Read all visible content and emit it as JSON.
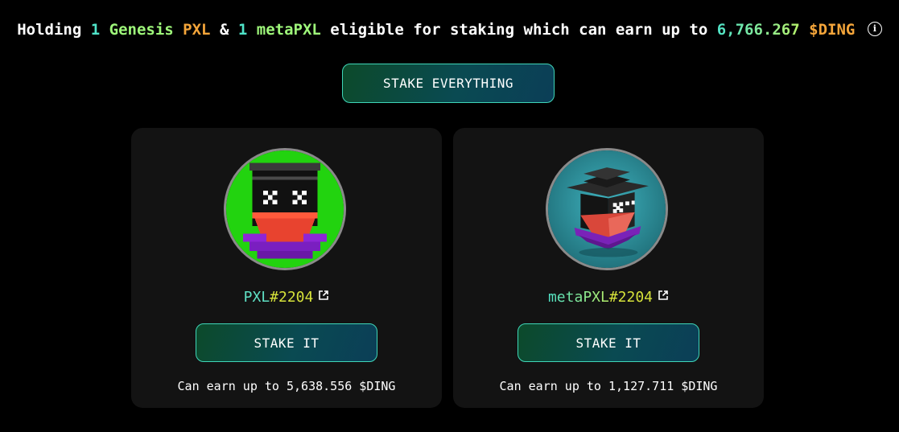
{
  "header": {
    "prefix": "Holding",
    "genesis_count": "1",
    "genesis_label": "Genesis",
    "pxl_label": "PXL",
    "amp": "&",
    "meta_count": "1",
    "meta_label": "metaPXL",
    "mid_text": "eligible for staking which can earn up to",
    "amount": "6,766.267",
    "token": "$DING",
    "info_icon": "info-icon"
  },
  "stake_everything_label": "STAKE EVERYTHING",
  "cards": [
    {
      "name_prefix": "PXL",
      "name_number": "#2204",
      "button_label": "STAKE IT",
      "earn_text": "Can earn up to 5,638.556 $DING",
      "icon": "external-link-icon",
      "avatar_bg": "#22d30f"
    },
    {
      "name_prefix": "metaPXL",
      "name_number": "#2204",
      "button_label": "STAKE IT",
      "earn_text": "Can earn up to 1,127.711 $DING",
      "icon": "external-link-icon",
      "avatar_bg": "#2a8c98"
    }
  ]
}
